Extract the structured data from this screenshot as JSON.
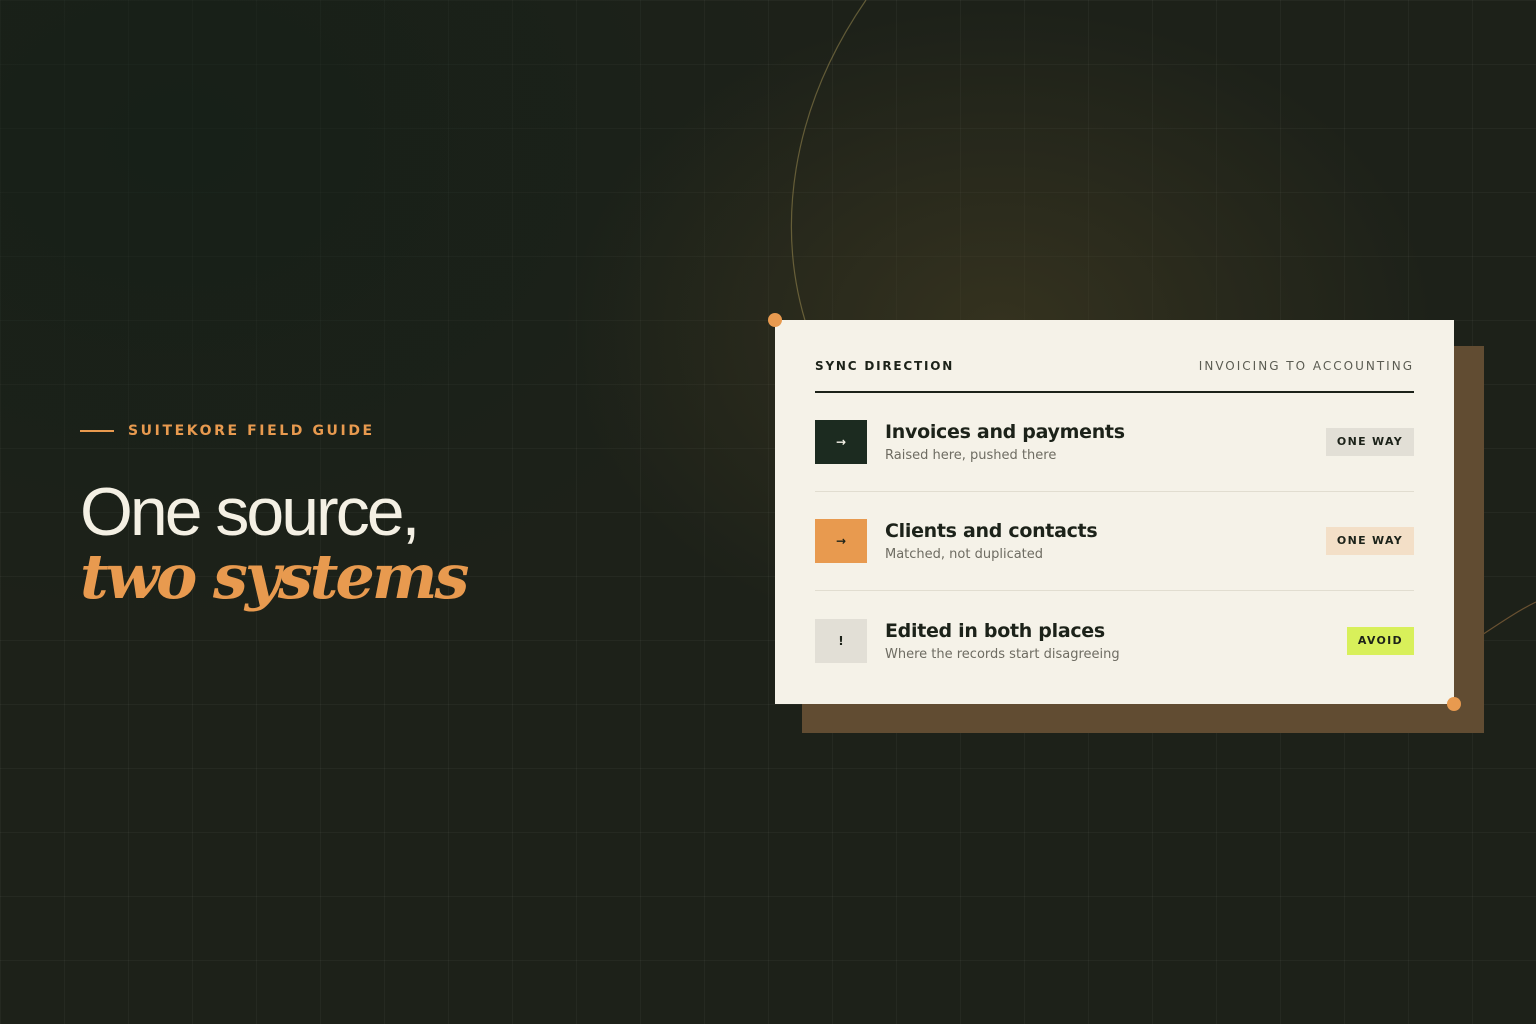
{
  "colors": {
    "background": "#1d2119",
    "accent_orange": "#e89a4f",
    "card_bg": "#f5f2e8",
    "card_shadow": "#614c32",
    "dark_green": "#1c2b20",
    "lime": "#d8f05a",
    "neutral_badge": "#e2dfd6",
    "peach_badge": "#f3dfc7"
  },
  "hero": {
    "eyebrow": "SUITEKORE FIELD GUIDE",
    "headline_line1": "One source,",
    "headline_line2": "two systems"
  },
  "card": {
    "header_left": "SYNC DIRECTION",
    "header_right": "INVOICING TO ACCOUNTING",
    "rows": [
      {
        "icon": "→",
        "icon_name": "arrow-right-icon",
        "icon_bg": "#1c2b20",
        "icon_color": "#f5f2e8",
        "title": "Invoices and payments",
        "subtitle": "Raised here, pushed there",
        "badge": "ONE WAY",
        "badge_bg": "#e2dfd6"
      },
      {
        "icon": "→",
        "icon_name": "arrow-right-icon",
        "icon_bg": "#e89a4f",
        "icon_color": "#1c2219",
        "title": "Clients and contacts",
        "subtitle": "Matched, not duplicated",
        "badge": "ONE WAY",
        "badge_bg": "#f3dfc7"
      },
      {
        "icon": "!",
        "icon_name": "exclamation-icon",
        "icon_bg": "#e2dfd6",
        "icon_color": "#1c2219",
        "title": "Edited in both places",
        "subtitle": "Where the records start disagreeing",
        "badge": "AVOID",
        "badge_bg": "#d8f05a"
      }
    ]
  }
}
